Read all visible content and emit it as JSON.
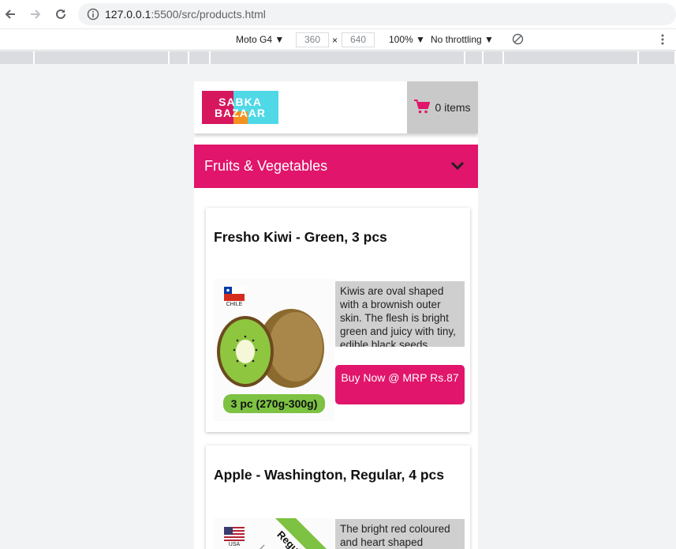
{
  "browser": {
    "url_host": "127.0.0.1",
    "url_path": ":5500/src/products.html",
    "device": "Moto G4 ▼",
    "width": "360",
    "times": "×",
    "height": "640",
    "zoom": "100% ▼",
    "throttle": "No throttling ▼"
  },
  "header": {
    "logo_line1": "SABKA",
    "logo_line2": "BAZAAR",
    "cart_label": "0 items"
  },
  "category": {
    "label": "Fruits & Vegetables"
  },
  "products": [
    {
      "title": "Fresho Kiwi - Green, 3 pcs",
      "flag_label": "CHILE",
      "pack_label": "3 pc (270g-300g)",
      "description": "Kiwis are oval shaped with a brownish outer skin. The flesh is bright green and juicy with tiny, edible black seeds.",
      "buy_label": "Buy Now @ MRP Rs.87"
    },
    {
      "title": "Apple - Washington, Regular, 4 pcs",
      "flag_label": "USA",
      "ribbon_label": "Regular",
      "description": "The bright red coloured and heart shaped"
    }
  ],
  "colors": {
    "accent": "#e0156b",
    "cart_bg": "#c9c9c9",
    "desc_bg": "#cfcfcf"
  }
}
